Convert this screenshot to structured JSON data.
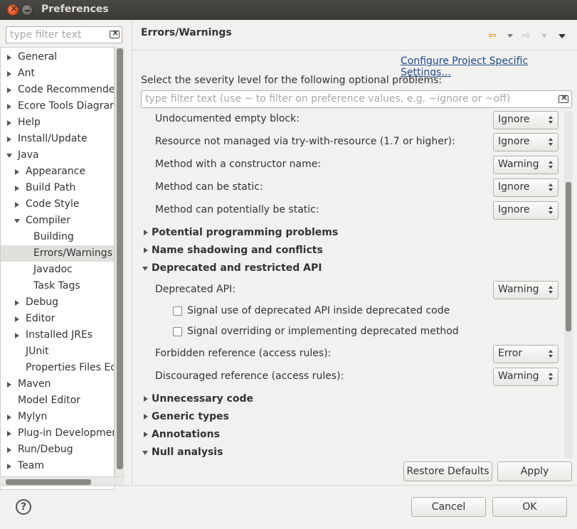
{
  "window": {
    "title": "Preferences"
  },
  "left": {
    "filter_placeholder": "type filter text",
    "tree": [
      {
        "label": "General",
        "level": 0,
        "expander": "right"
      },
      {
        "label": "Ant",
        "level": 0,
        "expander": "right"
      },
      {
        "label": "Code Recommenders",
        "level": 0,
        "expander": "right"
      },
      {
        "label": "Ecore Tools Diagram",
        "level": 0,
        "expander": "right"
      },
      {
        "label": "Help",
        "level": 0,
        "expander": "right"
      },
      {
        "label": "Install/Update",
        "level": 0,
        "expander": "right"
      },
      {
        "label": "Java",
        "level": 0,
        "expander": "down"
      },
      {
        "label": "Appearance",
        "level": 1,
        "expander": "right"
      },
      {
        "label": "Build Path",
        "level": 1,
        "expander": "right"
      },
      {
        "label": "Code Style",
        "level": 1,
        "expander": "right"
      },
      {
        "label": "Compiler",
        "level": 1,
        "expander": "down"
      },
      {
        "label": "Building",
        "level": 2,
        "expander": "none"
      },
      {
        "label": "Errors/Warnings",
        "level": 2,
        "expander": "none",
        "selected": true
      },
      {
        "label": "Javadoc",
        "level": 2,
        "expander": "none"
      },
      {
        "label": "Task Tags",
        "level": 2,
        "expander": "none"
      },
      {
        "label": "Debug",
        "level": 1,
        "expander": "right"
      },
      {
        "label": "Editor",
        "level": 1,
        "expander": "right"
      },
      {
        "label": "Installed JREs",
        "level": 1,
        "expander": "right"
      },
      {
        "label": "JUnit",
        "level": 1,
        "expander": "none"
      },
      {
        "label": "Properties Files Editor",
        "level": 1,
        "expander": "none"
      },
      {
        "label": "Maven",
        "level": 0,
        "expander": "right"
      },
      {
        "label": "Model Editor",
        "level": 0,
        "expander": "none"
      },
      {
        "label": "Mylyn",
        "level": 0,
        "expander": "right"
      },
      {
        "label": "Plug-in Development",
        "level": 0,
        "expander": "right"
      },
      {
        "label": "Run/Debug",
        "level": 0,
        "expander": "right"
      },
      {
        "label": "Team",
        "level": 0,
        "expander": "right"
      }
    ]
  },
  "right": {
    "title": "Errors/Warnings",
    "config_link": "Configure Project Specific Settings...",
    "severity_label": "Select the severity level for the following optional problems:",
    "filter_placeholder": "type filter text (use ~ to filter on preference values, e.g. ~ignore or ~off)",
    "options_top": [
      {
        "label": "Undocumented empty block:",
        "value": "Ignore"
      },
      {
        "label": "Resource not managed via try-with-resource (1.7 or higher):",
        "value": "Ignore"
      },
      {
        "label": "Method with a constructor name:",
        "value": "Warning"
      },
      {
        "label": "Method can be static:",
        "value": "Ignore"
      },
      {
        "label": "Method can potentially be static:",
        "value": "Ignore"
      }
    ],
    "sections": {
      "potential": "Potential programming problems",
      "shadowing": "Name shadowing and conflicts",
      "deprecated": "Deprecated and restricted API",
      "unnecessary": "Unnecessary code",
      "generic": "Generic types",
      "annotations": "Annotations",
      "null": "Null analysis"
    },
    "deprecated": {
      "api_label": "Deprecated API:",
      "api_value": "Warning",
      "chk1": "Signal use of deprecated API inside deprecated code",
      "chk2": "Signal overriding or implementing deprecated method",
      "forbidden_label": "Forbidden reference (access rules):",
      "forbidden_value": "Error",
      "discouraged_label": "Discouraged reference (access rules):",
      "discouraged_value": "Warning"
    },
    "buttons": {
      "restore": "Restore Defaults",
      "apply": "Apply"
    }
  },
  "footer": {
    "cancel": "Cancel",
    "ok": "OK",
    "help": "?"
  }
}
